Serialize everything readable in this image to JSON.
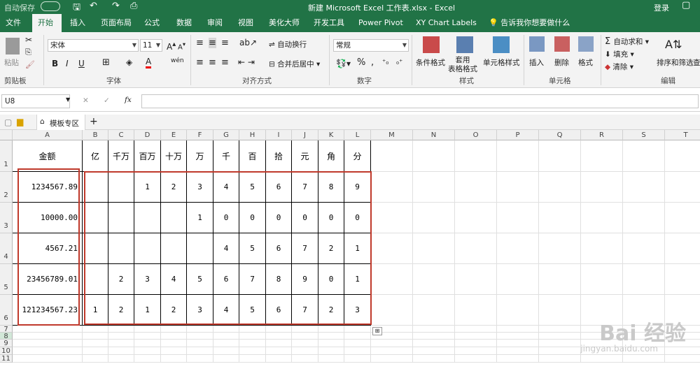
{
  "titlebar": {
    "autosave": "自动保存",
    "autosave_state": "关",
    "doc_title": "新建 Microsoft Excel 工作表.xlsx  -  Excel",
    "login": "登录"
  },
  "tabs": [
    "文件",
    "开始",
    "插入",
    "页面布局",
    "公式",
    "数据",
    "审阅",
    "视图",
    "美化大师",
    "开发工具",
    "Power Pivot",
    "XY Chart Labels"
  ],
  "active_tab": "开始",
  "tell_me": "告诉我你想要做什么",
  "ribbon": {
    "clipboard": {
      "paste": "粘贴",
      "label": "剪贴板"
    },
    "font": {
      "name": "宋体",
      "size": "11",
      "bold": "B",
      "italic": "I",
      "underline": "U",
      "label": "字体",
      "wen": "wén"
    },
    "align": {
      "wrap": "自动换行",
      "merge": "合并后居中",
      "label": "对齐方式"
    },
    "number": {
      "format": "常规",
      "percent": "%",
      "comma": ",",
      "label": "数字"
    },
    "styles": {
      "cond": "条件格式",
      "table": "套用\n表格格式",
      "cell": "单元格样式",
      "label": "样式"
    },
    "cells": {
      "insert": "插入",
      "delete": "删除",
      "format": "格式",
      "label": "单元格"
    },
    "editing": {
      "autosum": "自动求和",
      "fill": "填充",
      "clear": "清除",
      "sort": "排序和筛选",
      "find": "查",
      "label": "编辑"
    }
  },
  "formula_bar": {
    "name_box": "U8",
    "fx": "fx",
    "cancel": "✕",
    "confirm": "✓",
    "value": ""
  },
  "workbook_tab": "模板专区",
  "columns": [
    "A",
    "B",
    "C",
    "D",
    "E",
    "F",
    "G",
    "H",
    "I",
    "J",
    "K",
    "L",
    "M",
    "N",
    "O",
    "P",
    "Q",
    "R",
    "S",
    "T"
  ],
  "rows": [
    "1",
    "2",
    "3",
    "4",
    "5",
    "6",
    "7",
    "8",
    "9",
    "10",
    "11"
  ],
  "header_row": [
    "金额",
    "亿",
    "千万",
    "百万",
    "十万",
    "万",
    "千",
    "百",
    "拾",
    "元",
    "角",
    "分"
  ],
  "data_rows": [
    {
      "amount": "1234567.89",
      "digits": [
        "",
        "",
        "1",
        "2",
        "3",
        "4",
        "5",
        "6",
        "7",
        "8",
        "9"
      ]
    },
    {
      "amount": "10000.00",
      "digits": [
        "",
        "",
        "",
        "",
        "1",
        "0",
        "0",
        "0",
        "0",
        "0",
        "0"
      ]
    },
    {
      "amount": "4567.21",
      "digits": [
        "",
        "",
        "",
        "",
        "",
        "4",
        "5",
        "6",
        "7",
        "2",
        "1"
      ]
    },
    {
      "amount": "23456789.01",
      "digits": [
        "",
        "2",
        "3",
        "4",
        "5",
        "6",
        "7",
        "8",
        "9",
        "0",
        "1"
      ]
    },
    {
      "amount": "121234567.23",
      "digits": [
        "1",
        "2",
        "1",
        "2",
        "3",
        "4",
        "5",
        "6",
        "7",
        "2",
        "3"
      ]
    }
  ],
  "watermark": {
    "main": "Bai 经验",
    "sub": "jingyan.baidu.com"
  },
  "colors": {
    "brand": "#217346",
    "highlight": "#c0392b"
  }
}
